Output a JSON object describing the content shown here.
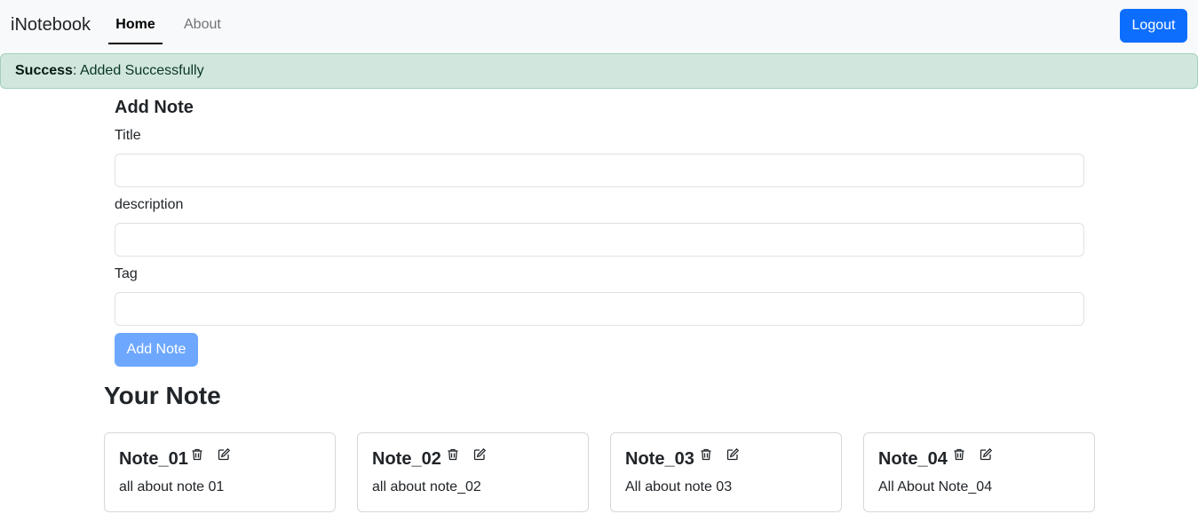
{
  "navbar": {
    "brand": "iNotebook",
    "links": [
      {
        "label": "Home",
        "active": true
      },
      {
        "label": "About",
        "active": false
      }
    ],
    "logout_label": "Logout"
  },
  "alert": {
    "type": "Success",
    "message": ": Added Successfully"
  },
  "form": {
    "title": "Add Note",
    "fields": [
      {
        "label": "Title",
        "value": ""
      },
      {
        "label": "description",
        "value": ""
      },
      {
        "label": "Tag",
        "value": ""
      }
    ],
    "submit_label": "Add Note"
  },
  "notes_section": {
    "title": "Your Note",
    "notes": [
      {
        "title": "Note_01",
        "description": "all about note 01"
      },
      {
        "title": "Note_02",
        "description": "all about note_02"
      },
      {
        "title": "Note_03",
        "description": "All about note 03"
      },
      {
        "title": "Note_04",
        "description": "All About Note_04"
      }
    ]
  },
  "colors": {
    "primary": "#0d6efd",
    "primary_disabled": "#6ea8fe",
    "success_bg": "#d1e7dd",
    "navbar_bg": "#f8f9fa"
  },
  "icons": {
    "delete": "trash-icon",
    "edit": "edit-icon"
  }
}
